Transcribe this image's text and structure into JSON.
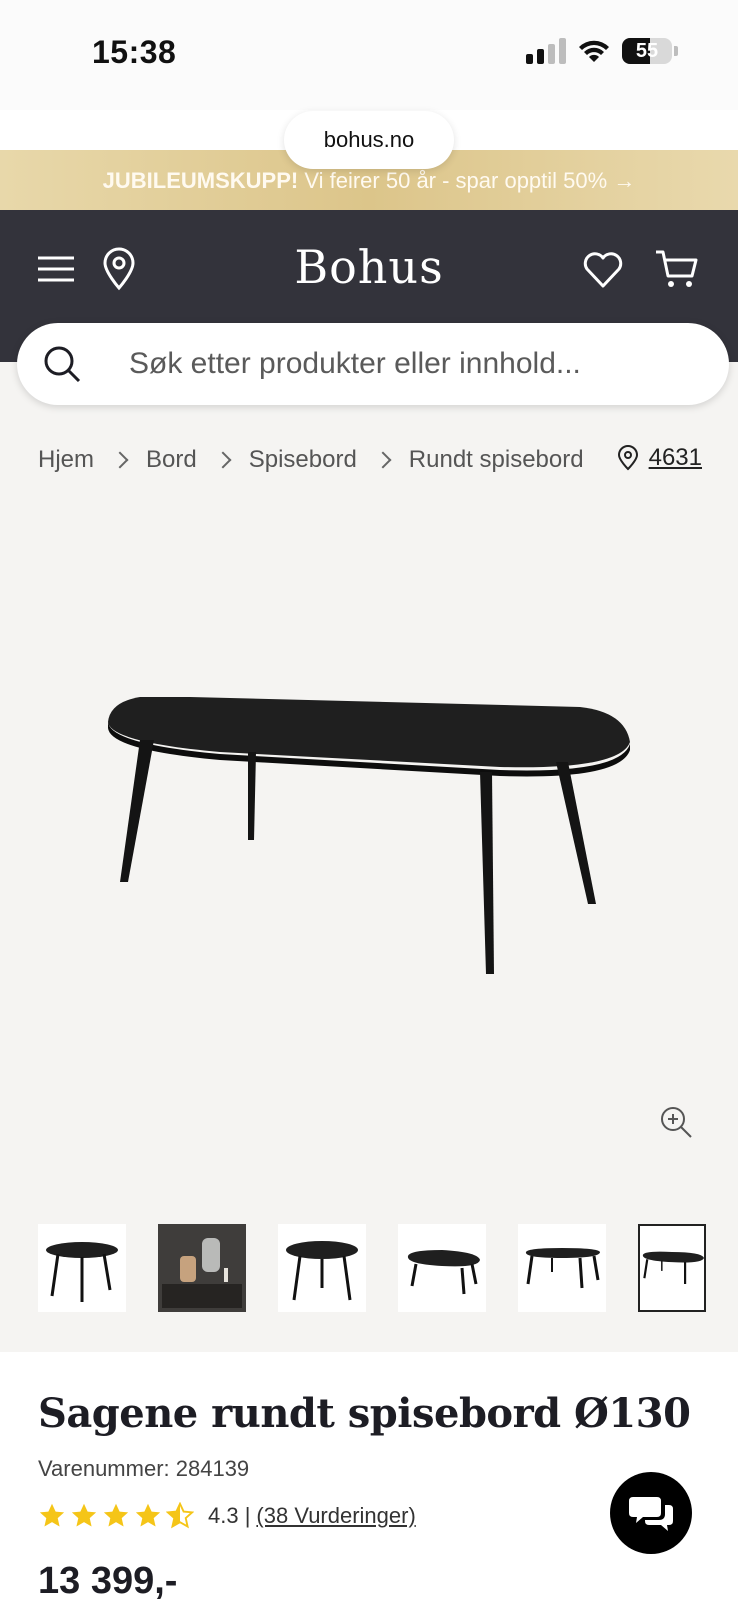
{
  "status_bar": {
    "time": "15:38",
    "battery": "55"
  },
  "browser": {
    "url": "bohus.no"
  },
  "promo": {
    "bold": "JUBILEUMSKUPP!",
    "text": " Vi feirer 50 år - spar opptil 50% →"
  },
  "header": {
    "logo": "Bohus"
  },
  "search": {
    "placeholder": "Søk etter produkter eller innhold..."
  },
  "breadcrumb": {
    "items": [
      "Hjem",
      "Bord",
      "Spisebord",
      "Rundt spisebord"
    ]
  },
  "store": {
    "code": "4631"
  },
  "thumbnails": {
    "count": 6,
    "active_index": 5
  },
  "product": {
    "title": "Sagene rundt spisebord Ø130",
    "sku": "Varenummer: 284139",
    "rating_value": "4.3 |",
    "rating_count": "(38 Vurderinger)",
    "rating_stars": 4.3,
    "price": "13 399,-"
  },
  "colors": {
    "header_bg": "#33333b",
    "promo_gold": "#dcc58a",
    "gallery_bg": "#f5f4f2",
    "star": "#f5c518"
  },
  "icons": [
    "menu-icon",
    "location-pin-icon",
    "heart-icon",
    "cart-icon",
    "search-icon",
    "zoom-in-icon",
    "chat-icon",
    "star-icon"
  ]
}
